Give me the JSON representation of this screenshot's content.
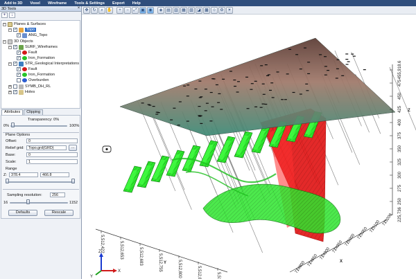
{
  "menu": [
    "Add to 3D",
    "Voxel",
    "Wireframe",
    "Tools & Settings",
    "Export",
    "Help"
  ],
  "toolbar": {
    "icons": [
      "pan-icon",
      "rotate-icon",
      "zoom-icon",
      "hand-icon",
      "zoom-in-icon",
      "zoom-out-icon",
      "zoom-extents-icon",
      "view-top-icon",
      "globe-icon",
      "view-iso-icon",
      "view-front-icon",
      "view-side-icon",
      "view-back-icon",
      "box-view-icon",
      "perspective-icon",
      "grid-icon",
      "axes-icon",
      "settings-icon",
      "light-icon"
    ]
  },
  "panel": {
    "title": "3D Tools",
    "tree": {
      "planes": "Planes & Surfaces",
      "topo": "Topo",
      "ang_topo": "ANG_Topo",
      "objects_3d": "3D Objects",
      "surf_wireframes": "SURF_Wireframes",
      "fault": "Fault",
      "iron_formation": "Iron_Formation",
      "str_geo": "STR_Geological Interpretations",
      "fault2": "Fault",
      "iron_formation2": "Iron_Formation",
      "overburden": "Overburden",
      "symb": "SYMB_DH_RL",
      "holes": "Holes"
    },
    "tabs": [
      "Attributes",
      "Clipping"
    ],
    "props": {
      "transparency_label": "Transparency: 0%",
      "min_pct": "0%",
      "max_pct": "100%",
      "plane_options": "Plane Options",
      "offset_label": "Offset:",
      "offset_value": "0",
      "relief_label": "Relief grid:",
      "relief_value": "Topo.grd(GRD)",
      "relief_btn": "...",
      "base_label": "Base:",
      "base_value": "0",
      "scale_label": "Scale:",
      "scale_value": "1",
      "range_label": "Range",
      "z_label": "Z:",
      "z_min": "378.4",
      "z_max": "466.8",
      "sampling_label": "Sampling resolution:",
      "sampling_value": "256",
      "sampling_min": "16",
      "sampling_max": "1152",
      "defaults_btn": "Defaults",
      "rescale_btn": "Rescale"
    }
  },
  "viewport": {
    "z_label": "Z",
    "z_ticks": [
      "455,918.6",
      "475",
      "450",
      "425",
      "400",
      "375",
      "350",
      "325",
      "300",
      "275",
      "250",
      "225,736"
    ],
    "x_label": "X",
    "x_ticks": [
      "714800",
      "714850",
      "714900",
      "714950",
      "715000",
      "715050",
      "715100",
      "715200"
    ],
    "y_label": "Y",
    "y_ticks": [
      "5,512,422",
      "5,512,653",
      "5,512,683",
      "5,512,755",
      "5,512,800",
      "5,512,850",
      "5,512,950"
    ],
    "triad": {
      "z": "Z",
      "y": "Y",
      "x": "X"
    },
    "colors": {
      "fault": "#e01212",
      "iron_formation": "#22dd22",
      "surface_top": "#8a4a33",
      "surface_bottom": "#2f8070",
      "holes": "#8c8c8c"
    }
  }
}
